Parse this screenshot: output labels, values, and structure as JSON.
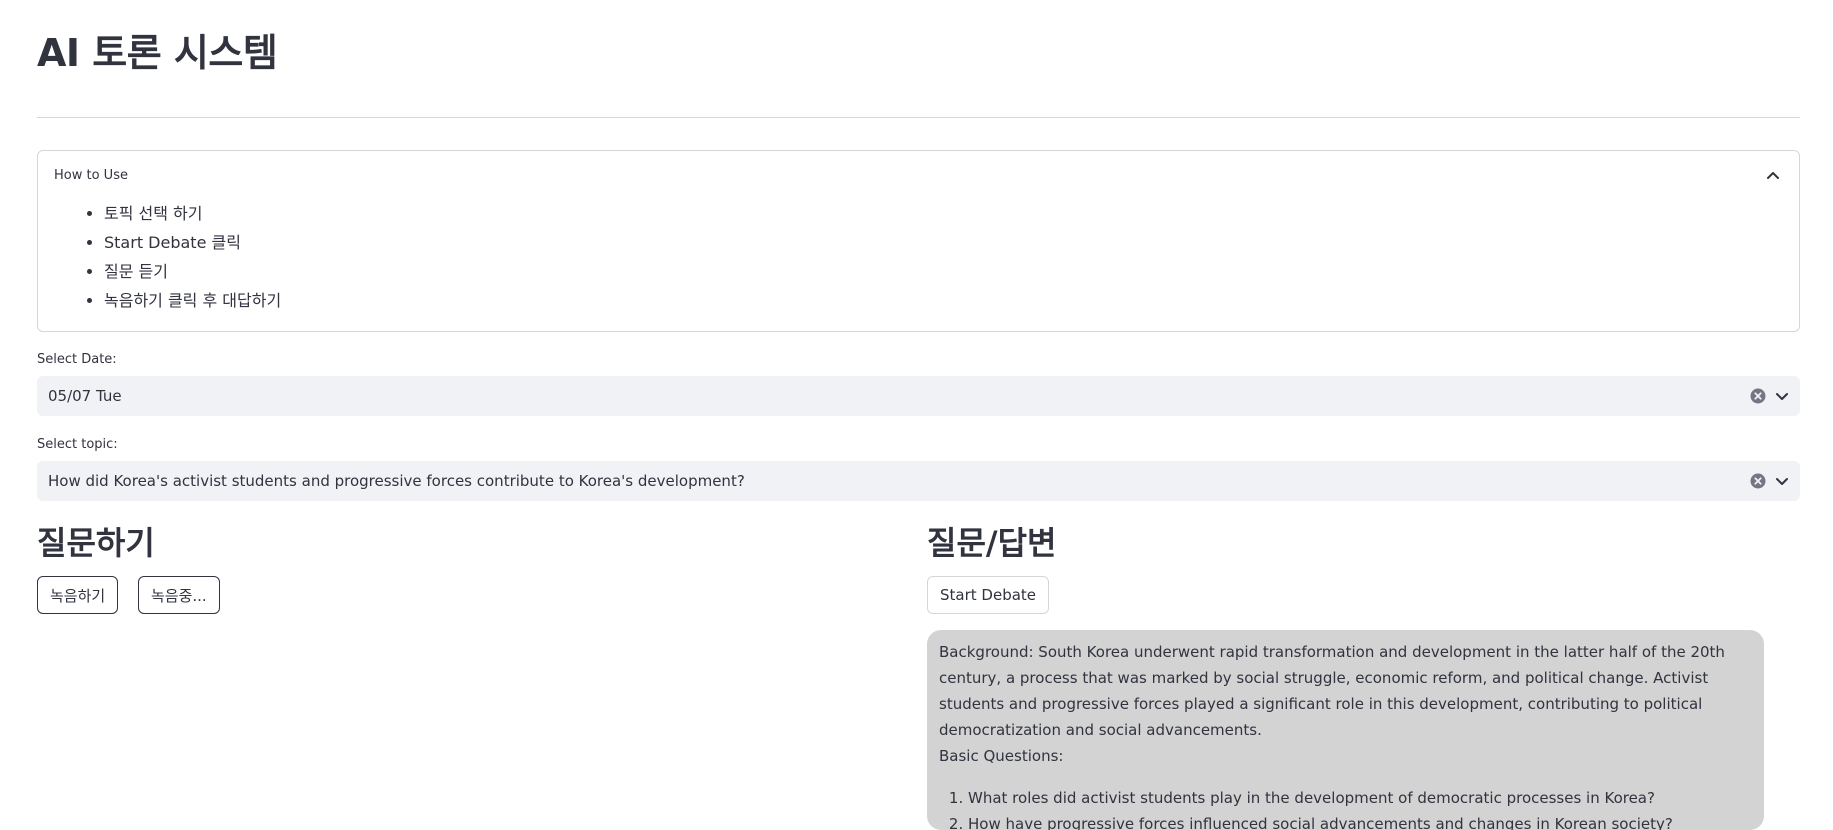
{
  "app": {
    "title": "AI 토론 시스템"
  },
  "how_to_use": {
    "label": "How to Use",
    "steps": [
      "토픽 선택 하기",
      "Start Debate 클릭",
      "질문 듣기",
      "녹음하기 클릭 후 대답하기"
    ]
  },
  "date_select": {
    "label": "Select Date:",
    "value": "05/07 Tue"
  },
  "topic_select": {
    "label": "Select topic:",
    "value": "How did Korea's activist students and progressive forces contribute to Korea's development?"
  },
  "ask": {
    "title": "질문하기",
    "record_label": "녹음하기",
    "recording_label": "녹음중..."
  },
  "qa": {
    "title": "질문/답변",
    "start_label": "Start Debate",
    "background": "Background: South Korea underwent rapid transformation and development in the latter half of the 20th century, a process that was marked by social struggle, economic reform, and political change. Activist students and progressive forces played a significant role in this development, contributing to political democratization and social advancements.",
    "basic_questions_label": "Basic Questions:",
    "questions": [
      "What roles did activist students play in the development of democratic processes in Korea?",
      "How have progressive forces influenced social advancements and changes in Korean society?"
    ]
  }
}
